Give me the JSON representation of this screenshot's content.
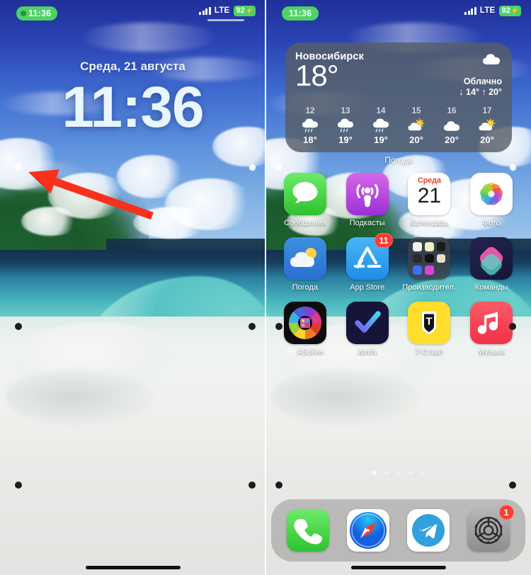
{
  "meta": {
    "description": "Side-by-side iPhone screenshots: lock screen (left) and home screen (right), Russian locale"
  },
  "status_bar": {
    "time": "11:36",
    "carrier_network": "LTE",
    "battery": "92",
    "battery_bolt": "⚡",
    "recording_icon": "screen-record-dot",
    "signal_icon": "cellular-signal-icon"
  },
  "lock_screen": {
    "date": "Среда, 21 августа",
    "time": "11:36"
  },
  "annotation": {
    "arrow_color": "#f8301c",
    "arrow_label": "red-arrow-pointing-left"
  },
  "home_screen": {
    "widget": {
      "city": "Новосибирск",
      "temperature": "18°",
      "condition": "Облачно",
      "hi_lo": "↓ 14° ↑ 20°",
      "header_icon": "cloud-icon",
      "label": "Погода",
      "hours": [
        {
          "hour": "12",
          "icon": "cloud-rain-icon",
          "temp": "18°"
        },
        {
          "hour": "13",
          "icon": "cloud-rain-icon",
          "temp": "19°"
        },
        {
          "hour": "14",
          "icon": "cloud-rain-icon",
          "temp": "19°"
        },
        {
          "hour": "15",
          "icon": "sun-behind-cloud-icon",
          "temp": "20°"
        },
        {
          "hour": "16",
          "icon": "cloud-icon",
          "temp": "20°"
        },
        {
          "hour": "17",
          "icon": "sun-behind-cloud-icon",
          "temp": "20°"
        }
      ]
    },
    "rows": [
      [
        {
          "label": "Сообщения",
          "icon": "messages-app-icon",
          "badge": ""
        },
        {
          "label": "Подкасты",
          "icon": "podcasts-app-icon",
          "badge": ""
        },
        {
          "label": "Календарь",
          "icon": "calendar-app-icon",
          "badge": "",
          "cal_weekday": "Среда",
          "cal_day": "21"
        },
        {
          "label": "Фото",
          "icon": "photos-app-icon",
          "badge": ""
        }
      ],
      [
        {
          "label": "Погода",
          "icon": "weather-app-icon",
          "badge": ""
        },
        {
          "label": "App Store",
          "icon": "app-store-icon",
          "badge": "11"
        },
        {
          "label": "Производител...",
          "icon": "folder-icon",
          "badge": ""
        },
        {
          "label": "Команды",
          "icon": "shortcuts-app-icon",
          "badge": ""
        }
      ],
      [
        {
          "label": "ASolver",
          "icon": "asolver-app-icon",
          "badge": "",
          "cloud": true
        },
        {
          "label": "vpnify",
          "icon": "vpnify-app-icon",
          "badge": ""
        },
        {
          "label": "Т-Старт",
          "icon": "tstart-app-icon",
          "badge": ""
        },
        {
          "label": "Музыка",
          "icon": "music-app-icon",
          "badge": ""
        }
      ]
    ],
    "page_dots": {
      "count": 5,
      "active_index": 0
    },
    "dock": [
      {
        "label": "Телефон",
        "icon": "phone-app-icon",
        "badge": ""
      },
      {
        "label": "Safari",
        "icon": "safari-app-icon",
        "badge": ""
      },
      {
        "label": "Telegram",
        "icon": "telegram-app-icon",
        "badge": ""
      },
      {
        "label": "Настройки",
        "icon": "settings-app-icon",
        "badge": "1"
      }
    ]
  },
  "colors": {
    "accent_green": "#4cd364",
    "badge_red": "#ff3b30",
    "arrow_red": "#f8301c",
    "widget_bg": "rgba(86,94,103,.82)"
  }
}
